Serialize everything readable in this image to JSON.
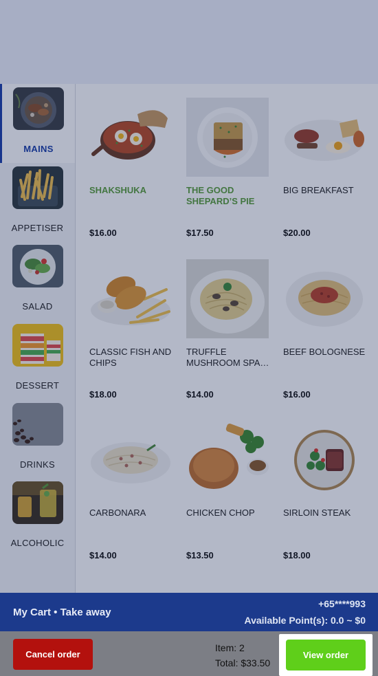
{
  "categories": [
    {
      "label": "MAINS",
      "icon": "mains-photo-icon",
      "active": true
    },
    {
      "label": "APPETISER",
      "icon": "fries-photo-icon"
    },
    {
      "label": "SALAD",
      "icon": "salad-photo-icon"
    },
    {
      "label": "DESSERT",
      "icon": "cake-photo-icon"
    },
    {
      "label": "DRINKS",
      "icon": "coffee-beans-photo-icon"
    },
    {
      "label": "ALCOHOLIC",
      "icon": "cocktail-photo-icon"
    }
  ],
  "menu_items": [
    {
      "name": "SHAKSHUKA",
      "price": "$16.00",
      "icon": "shakshuka-photo-icon"
    },
    {
      "name": "THE GOOD SHEPARD’S PIE",
      "price": "$17.50",
      "icon": "shepards-pie-photo-icon"
    },
    {
      "name": "BIG BREAKFAST",
      "price": "$20.00",
      "icon": "big-breakfast-photo-icon"
    },
    {
      "name": "CLASSIC FISH AND CHIPS",
      "price": "$18.00",
      "icon": "fish-and-chips-photo-icon"
    },
    {
      "name": "TRUFFLE MUSHROOM SPA…",
      "price": "$14.00",
      "icon": "truffle-pasta-photo-icon"
    },
    {
      "name": "BEEF BOLOGNESE",
      "price": "$16.00",
      "icon": "bolognese-photo-icon"
    },
    {
      "name": "CARBONARA",
      "price": "$14.00",
      "icon": "carbonara-photo-icon"
    },
    {
      "name": "CHICKEN CHOP",
      "price": "$13.50",
      "icon": "chicken-chop-photo-icon"
    },
    {
      "name": "SIRLOIN STEAK",
      "price": "$18.00",
      "icon": "sirloin-steak-photo-icon"
    }
  ],
  "cart": {
    "title": "My Cart • Take away",
    "phone": "+65****993",
    "points": "Available Point(s): 0.0 ~ $0"
  },
  "footer": {
    "cancel_label": "Cancel order",
    "item_label": "Item:",
    "item_value": "2",
    "total_label": "Total:",
    "total_value": "$33.50",
    "view_label": "View order"
  },
  "colors": {
    "brand_blue": "#1c3a8c",
    "cancel_red": "#b3110d",
    "view_green": "#5fcf1a",
    "highlight_name_green": "#5a9e3a"
  }
}
